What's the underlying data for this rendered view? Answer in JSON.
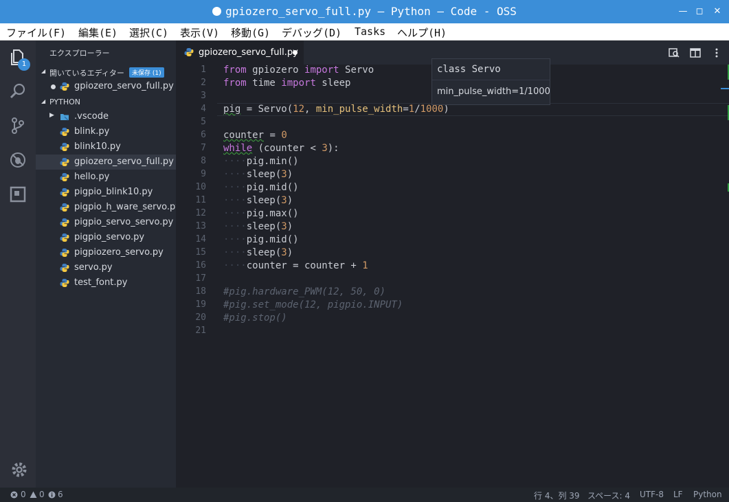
{
  "window": {
    "title": "gpiozero_servo_full.py — Python — Code - OSS"
  },
  "menu": [
    "ファイル(F)",
    "編集(E)",
    "選択(C)",
    "表示(V)",
    "移動(G)",
    "デバッグ(D)",
    "Tasks",
    "ヘルプ(H)"
  ],
  "activity": {
    "explorer_badge": "1"
  },
  "sidebar": {
    "title": "エクスプローラー",
    "open_editors": {
      "label": "開いているエディター",
      "badge": "未保存 (1)",
      "files": [
        "gpiozero_servo_full.py"
      ]
    },
    "folder": {
      "label": "PYTHON",
      "subfolder": ".vscode",
      "files": [
        "blink.py",
        "blink10.py",
        "gpiozero_servo_full.py",
        "hello.py",
        "pigpio_blink10.py",
        "pigpio_h_ware_servo.py",
        "pigpio_servo_servo.py",
        "pigpio_servo.py",
        "pigpiozero_servo.py",
        "servo.py",
        "test_font.py"
      ],
      "selected": "gpiozero_servo_full.py"
    }
  },
  "editor": {
    "tab": "gpiozero_servo_full.py",
    "line_numbers": [
      "1",
      "2",
      "3",
      "4",
      "5",
      "6",
      "7",
      "8",
      "9",
      "10",
      "11",
      "12",
      "13",
      "14",
      "15",
      "16",
      "17",
      "18",
      "19",
      "20",
      "21"
    ],
    "code": [
      [
        {
          "t": "from",
          "c": "kw"
        },
        {
          "t": " gpiozero "
        },
        {
          "t": "import",
          "c": "kw"
        },
        {
          "t": " Servo"
        }
      ],
      [
        {
          "t": "from",
          "c": "kw"
        },
        {
          "t": " time "
        },
        {
          "t": "import",
          "c": "kw"
        },
        {
          "t": " sleep"
        }
      ],
      [],
      [
        {
          "t": "pig",
          "c": "squig"
        },
        {
          "t": " = Servo("
        },
        {
          "t": "12",
          "c": "num"
        },
        {
          "t": ", "
        },
        {
          "t": "min_pulse_width",
          "c": "param"
        },
        {
          "t": "="
        },
        {
          "t": "1",
          "c": "num"
        },
        {
          "t": "/"
        },
        {
          "t": "1000",
          "c": "num"
        },
        {
          "t": ")"
        }
      ],
      [],
      [
        {
          "t": "counter",
          "c": "squig"
        },
        {
          "t": " = "
        },
        {
          "t": "0",
          "c": "num"
        }
      ],
      [
        {
          "t": "while",
          "c": "kw squig"
        },
        {
          "t": " (counter < "
        },
        {
          "t": "3",
          "c": "num"
        },
        {
          "t": "):"
        }
      ],
      [
        {
          "t": "····",
          "c": "ws"
        },
        {
          "t": "pig.min()"
        }
      ],
      [
        {
          "t": "····",
          "c": "ws"
        },
        {
          "t": "sleep("
        },
        {
          "t": "3",
          "c": "num"
        },
        {
          "t": ")"
        }
      ],
      [
        {
          "t": "····",
          "c": "ws"
        },
        {
          "t": "pig.mid()"
        }
      ],
      [
        {
          "t": "····",
          "c": "ws"
        },
        {
          "t": "sleep("
        },
        {
          "t": "3",
          "c": "num"
        },
        {
          "t": ")"
        }
      ],
      [
        {
          "t": "····",
          "c": "ws"
        },
        {
          "t": "pig.max()"
        }
      ],
      [
        {
          "t": "····",
          "c": "ws"
        },
        {
          "t": "sleep("
        },
        {
          "t": "3",
          "c": "num"
        },
        {
          "t": ")"
        }
      ],
      [
        {
          "t": "····",
          "c": "ws"
        },
        {
          "t": "pig.mid()"
        }
      ],
      [
        {
          "t": "····",
          "c": "ws"
        },
        {
          "t": "sleep("
        },
        {
          "t": "3",
          "c": "num"
        },
        {
          "t": ")"
        }
      ],
      [
        {
          "t": "····",
          "c": "ws"
        },
        {
          "t": "counter = counter + "
        },
        {
          "t": "1",
          "c": "num"
        }
      ],
      [],
      [
        {
          "t": "#pig.hardware_PWM(12, 50, 0)",
          "c": "cmt"
        }
      ],
      [
        {
          "t": "#pig.set_mode(12, pigpio.INPUT)",
          "c": "cmt"
        }
      ],
      [
        {
          "t": "#pig.stop()",
          "c": "cmt"
        }
      ],
      []
    ],
    "hover": {
      "signature": "class Servo",
      "detail": "min_pulse_width=1/1000"
    }
  },
  "status": {
    "errors": "0",
    "warnings": "0",
    "infos": "6",
    "position": "行 4、列 39",
    "spaces": "スペース: 4",
    "encoding": "UTF-8",
    "eol": "LF",
    "language": "Python"
  },
  "colors": {
    "accent": "#3b8ed8",
    "keyword": "#c678dd",
    "number": "#d19a66",
    "param": "#e5c07b",
    "python_blue": "#3f7cbf",
    "python_yellow": "#f5c942"
  }
}
